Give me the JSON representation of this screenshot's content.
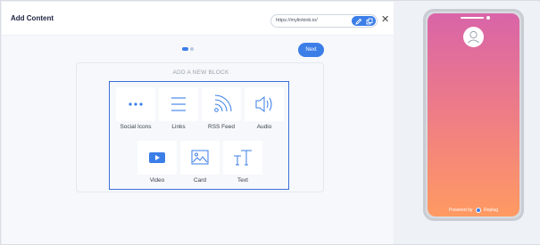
{
  "header": {
    "title": "Add Content",
    "url": "https://mylinkinb.io/",
    "edit_icon": "pencil-icon",
    "copy_icon": "copy-icon",
    "close_label": "✕"
  },
  "stepper": {
    "current_step": 1,
    "total_steps": 2,
    "next_label": "Next"
  },
  "blocks": {
    "heading": "ADD A NEW BLOCK",
    "items": [
      {
        "label": "Social Icons",
        "icon": "ellipsis-icon"
      },
      {
        "label": "Links",
        "icon": "list-lines-icon"
      },
      {
        "label": "RSS Feed",
        "icon": "rss-icon"
      },
      {
        "label": "Audio",
        "icon": "speaker-icon"
      },
      {
        "label": "Video",
        "icon": "play-icon"
      },
      {
        "label": "Card",
        "icon": "image-icon"
      },
      {
        "label": "Text",
        "icon": "text-icon"
      }
    ]
  },
  "preview": {
    "avatar_icon": "user-avatar-icon",
    "powered_prefix": "Powered by",
    "powered_brand": "Replug",
    "gradient_colors": [
      "#d964a8",
      "#ff9a62"
    ]
  },
  "colors": {
    "accent": "#3b7ee8",
    "grid_border": "#3b6fd8"
  }
}
